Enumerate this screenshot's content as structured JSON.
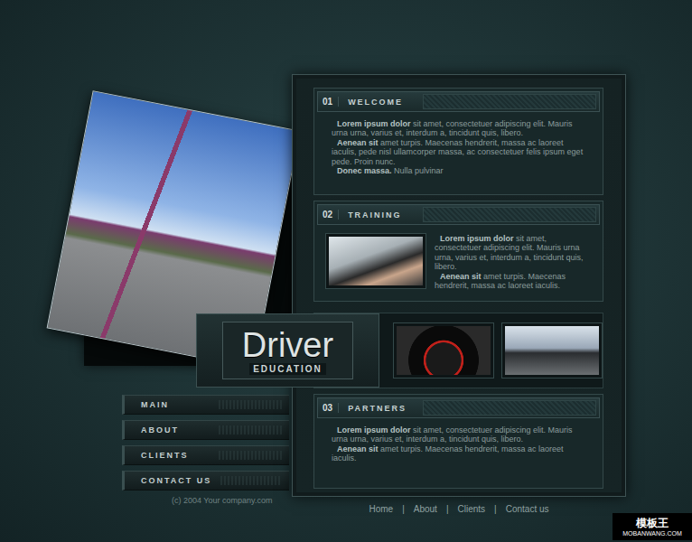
{
  "sections": [
    {
      "number": "01",
      "title": "WELCOME",
      "kind": "text",
      "paragraphs": [
        [
          {
            "text": "Lorem ipsum dolor",
            "bold": true
          },
          {
            "text": " sit amet, consectetuer adipiscing elit. Mauris urna urna, varius et, interdum a, tincidunt quis, libero.",
            "bold": false
          }
        ],
        [
          {
            "text": "Aenean sit",
            "bold": true
          },
          {
            "text": " amet turpis. Maecenas hendrerit, massa ac laoreet iaculis, pede nisl ullamcorper massa, ac consectetuer felis ipsum eget pede. Proin nunc.",
            "bold": false
          }
        ],
        [
          {
            "text": "Donec massa.",
            "bold": true
          },
          {
            "text": " Nulla pulvinar",
            "bold": false
          }
        ]
      ]
    },
    {
      "number": "02",
      "title": "TRAINING",
      "kind": "image-text",
      "paragraphs": [
        [
          {
            "text": "Lorem ipsum dolor",
            "bold": true
          },
          {
            "text": " sit amet, consectetuer adipiscing elit. Mauris urna urna, varius et, interdum a, tincidunt quis, libero.",
            "bold": false
          }
        ],
        [
          {
            "text": "Aenean sit",
            "bold": true
          },
          {
            "text": " amet turpis. Maecenas hendrerit, massa ac laoreet iaculis.",
            "bold": false
          }
        ]
      ]
    },
    {
      "number": "03",
      "title": "PARTNERS",
      "kind": "text",
      "paragraphs": [
        [
          {
            "text": "Lorem ipsum dolor",
            "bold": true
          },
          {
            "text": " sit amet, consectetuer adipiscing elit. Mauris urna urna, varius et, interdum a, tincidunt quis, libero.",
            "bold": false
          }
        ],
        [
          {
            "text": "Aenean sit",
            "bold": true
          },
          {
            "text": " amet turpis. Maecenas hendrerit, massa ac laoreet iaculis.",
            "bold": false
          }
        ]
      ]
    }
  ],
  "logo": {
    "title": "Driver",
    "subtitle": "EDUCATION"
  },
  "nav": [
    {
      "label": "MAIN"
    },
    {
      "label": "ABOUT"
    },
    {
      "label": "CLIENTS"
    },
    {
      "label": "CONTACT US"
    }
  ],
  "copyright": "(c) 2004 Your company.com",
  "footer": {
    "links": [
      "Home",
      "About",
      "Clients",
      "Contact us"
    ],
    "separator": "|"
  },
  "watermark": {
    "brand": "模板王",
    "url": "MOBANWANG.COM"
  }
}
